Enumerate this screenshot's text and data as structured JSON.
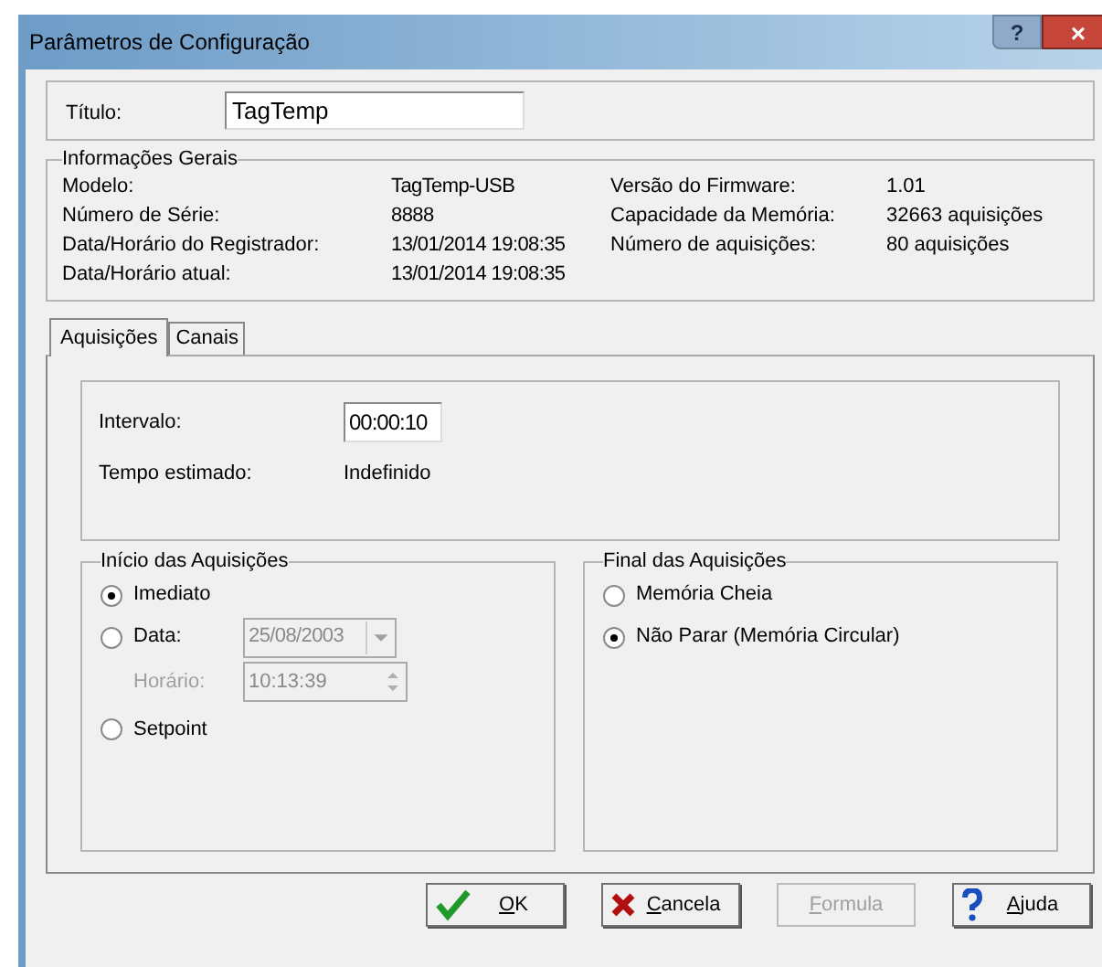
{
  "window": {
    "title": "Parâmetros de Configuração",
    "help_button": "?",
    "close_button": "×"
  },
  "title_field": {
    "label": "Título:",
    "value": "TagTemp"
  },
  "general_info": {
    "legend": "Informações Gerais",
    "rows": [
      {
        "label": "Modelo:",
        "value": "TagTemp-USB",
        "label_2": "Versão do Firmware:",
        "value_2": "1.01"
      },
      {
        "label": "Número de Série:",
        "value": "8888",
        "label_2": "Capacidade da Memória:",
        "value_2": "32663 aquisições"
      },
      {
        "label": "Data/Horário do Registrador:",
        "value": "13/01/2014 19:08:35",
        "label_2": "Número de aquisições:",
        "value_2": "80 aquisições"
      },
      {
        "label": "Data/Horário atual:",
        "value": "13/01/2014 19:08:35"
      }
    ]
  },
  "tabs": [
    {
      "label": "Aquisições",
      "selected": true
    },
    {
      "label": "Canais",
      "selected": false
    }
  ],
  "interval": {
    "label": "Intervalo:",
    "value": "00:00:10"
  },
  "estimated": {
    "label": "Tempo estimado:",
    "value": "Indefinido"
  },
  "start": {
    "legend": "Início das Aquisições",
    "options": [
      {
        "label": "Imediato",
        "selected": true
      },
      {
        "label": "Data:",
        "selected": false
      },
      {
        "label": "Setpoint",
        "selected": false
      }
    ],
    "date": {
      "value": "25/08/2003",
      "disabled": true
    },
    "time": {
      "label": "Horário:",
      "value": "10:13:39",
      "disabled": true
    }
  },
  "end": {
    "legend": "Final das Aquisições",
    "options": [
      {
        "label": "Memória Cheia",
        "selected": false
      },
      {
        "label": "Não Parar (Memória Circular)",
        "selected": true
      }
    ]
  },
  "buttons": [
    {
      "kind": "ok",
      "label": "OK",
      "disabled": false
    },
    {
      "kind": "cancel",
      "label": "Cancela",
      "disabled": false
    },
    {
      "kind": "formula",
      "label": "Formula",
      "disabled": true
    },
    {
      "kind": "help",
      "label": "Ajuda",
      "disabled": false
    }
  ]
}
